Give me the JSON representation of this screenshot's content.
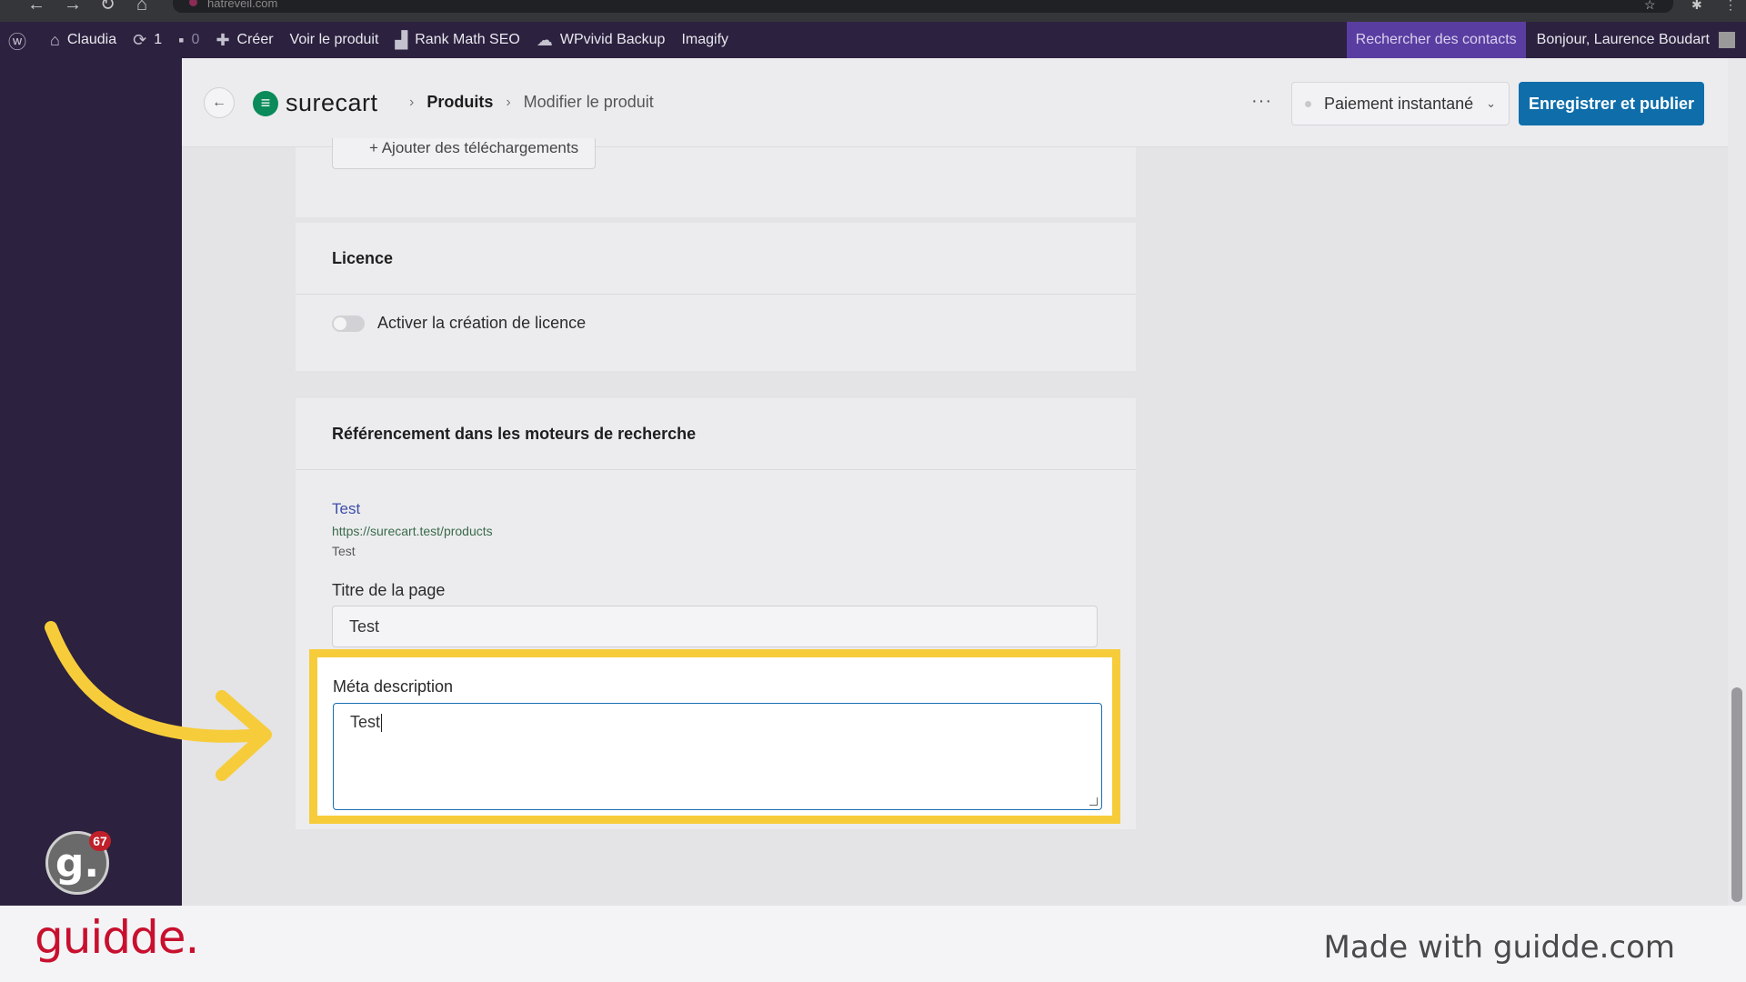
{
  "browser": {
    "url": "hatreveil.com"
  },
  "adminbar": {
    "site_name": "Claudia",
    "updates_count": "1",
    "comments_count": "0",
    "create_label": "Créer",
    "view_product_label": "Voir le produit",
    "rankmath_label": "Rank Math SEO",
    "wpvivid_label": "WPvivid Backup",
    "imagify_label": "Imagify",
    "search_contacts_label": "Rechercher des contacts",
    "greeting": "Bonjour, Laurence Boudart"
  },
  "header": {
    "logo_text": "surecart",
    "breadcrumb": [
      "Produits",
      "Modifier le produit"
    ],
    "more_label": "···",
    "status_select_value": "Paiement instantané",
    "publish_label": "Enregistrer et publier"
  },
  "downloads": {
    "button_label": "+ Ajouter des téléchargements"
  },
  "licence": {
    "title": "Licence",
    "toggle_label": "Activer la création de licence",
    "toggle_on": false
  },
  "seo": {
    "title": "Référencement dans les moteurs de recherche",
    "preview": {
      "title": "Test",
      "url": "https://surecart.test/products",
      "description": "Test"
    },
    "page_title_label": "Titre de la page",
    "page_title_value": "Test",
    "meta_label": "Méta description",
    "meta_value": "Test"
  },
  "colors": {
    "admin_bar": "#2c213f",
    "accent_blue": "#0f6eaa",
    "highlight_yellow": "#f7cc3b",
    "brand_red": "#c8102e"
  },
  "guidde": {
    "badge_letter": "g.",
    "badge_count": "67",
    "brand": "guidde.",
    "made_with": "Made with guidde.com"
  }
}
